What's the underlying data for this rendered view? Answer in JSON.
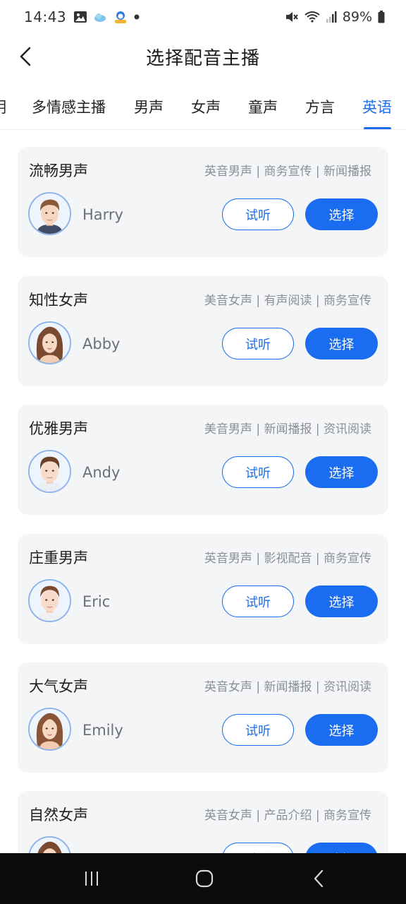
{
  "status_bar": {
    "time": "14:43",
    "battery": "89%",
    "left_icons": [
      "image-icon",
      "cloud-icon",
      "mascot-icon",
      "dot-icon"
    ],
    "right_icons": [
      "mute-icon",
      "wifi-icon",
      "signal-icon",
      "battery-icon"
    ]
  },
  "header": {
    "title": "选择配音主播"
  },
  "tabs": [
    {
      "label": "明",
      "active": false
    },
    {
      "label": "多情感主播",
      "active": false
    },
    {
      "label": "男声",
      "active": false
    },
    {
      "label": "女声",
      "active": false
    },
    {
      "label": "童声",
      "active": false
    },
    {
      "label": "方言",
      "active": false
    },
    {
      "label": "英语",
      "active": true
    }
  ],
  "cards": [
    {
      "title": "流畅男声",
      "tags": "英音男声 | 商务宣传 | 新闻播报",
      "name": "Harry",
      "gender": "male",
      "listen": "试听",
      "select": "选择"
    },
    {
      "title": "知性女声",
      "tags": "美音女声 | 有声阅读 | 商务宣传",
      "name": "Abby",
      "gender": "female",
      "listen": "试听",
      "select": "选择"
    },
    {
      "title": "优雅男声",
      "tags": "美音男声 | 新闻播报 | 资讯阅读",
      "name": "Andy",
      "gender": "male",
      "listen": "试听",
      "select": "选择"
    },
    {
      "title": "庄重男声",
      "tags": "英音男声 | 影视配音 | 商务宣传",
      "name": "Eric",
      "gender": "male",
      "listen": "试听",
      "select": "选择"
    },
    {
      "title": "大气女声",
      "tags": "英音女声 | 新闻播报 | 资讯阅读",
      "name": "Emily",
      "gender": "female",
      "listen": "试听",
      "select": "选择"
    },
    {
      "title": "自然女声",
      "tags": "英音女声 | 产品介绍 | 商务宣传",
      "name": "",
      "gender": "female",
      "listen": "试听",
      "select": "选择"
    }
  ],
  "colors": {
    "accent": "#1a6df0",
    "card_bg": "#f4f5f7",
    "tag_text": "#8a8f99",
    "nav_bg": "#0b0b0c"
  }
}
